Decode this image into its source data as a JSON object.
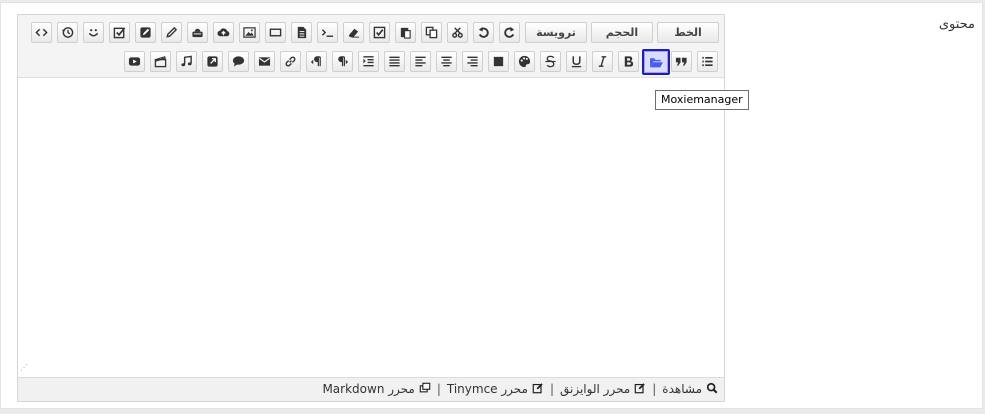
{
  "field": {
    "label": "محتوى"
  },
  "toolbar": {
    "font_label": "الخط",
    "size_label": "الحجم",
    "heading_label": "ترويسة"
  },
  "tooltip": {
    "text": "Moxiemanager"
  },
  "statusbar": {
    "preview_label": "مشاهدة",
    "wysiwyg_label": "محرر الوايزنق",
    "tinymce_label": "محرر Tinymce",
    "markdown_label": "محرر Markdown",
    "separator": "|"
  },
  "resize_grip": "⋰",
  "icons": {
    "row1": [
      "smile-icon",
      "history-icon",
      "source-code-icon"
    ],
    "active": "folder-open-icon"
  },
  "colors": {
    "active_border": "#1f1fa8",
    "active_bg": "#d9dcff"
  }
}
